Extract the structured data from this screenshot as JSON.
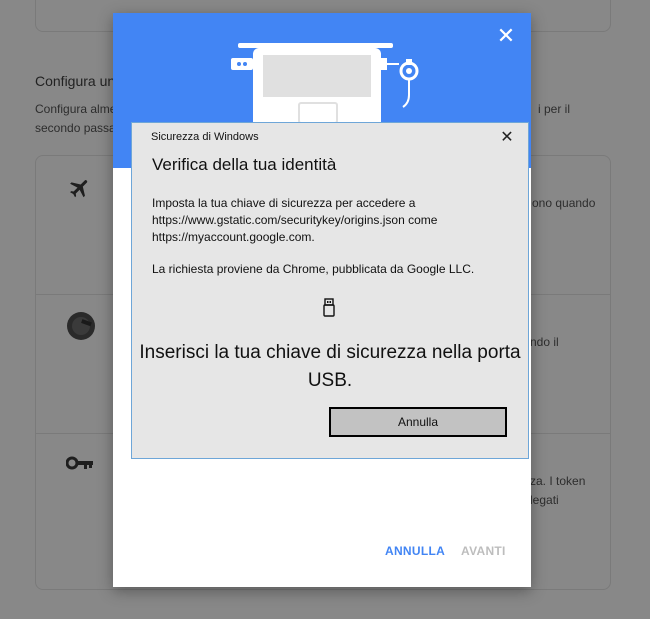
{
  "background": {
    "section_title": "Configura un",
    "section_desc": "Configura almeno secondo passa",
    "section_desc_right": "i per il",
    "rows": [
      {
        "icon": "airplane-icon",
        "text": "ono quando"
      },
      {
        "icon": "phone-disc-icon",
        "text": "ndo il"
      },
      {
        "icon": "key-icon",
        "text": "za. I token legati"
      }
    ]
  },
  "google_dialog": {
    "cancel_label": "ANNULLA",
    "next_label": "AVANTI",
    "close_icon": "close-icon",
    "colors": {
      "header": "#4285f4",
      "cancel": "#4285f4",
      "next_disabled": "#bdbdbd"
    }
  },
  "windows_dialog": {
    "title": "Sicurezza di Windows",
    "heading": "Verifica della tua identità",
    "body": "Imposta la tua chiave di sicurezza per accedere a https://www.gstatic.com/securitykey/origins.json come https://myaccount.google.com.",
    "origin": "La richiesta proviene da Chrome, pubblicata da Google LLC.",
    "usb_icon": "usb-key-icon",
    "instruction": "Inserisci la tua chiave di sicurezza nella porta USB.",
    "cancel_label": "Annulla"
  }
}
